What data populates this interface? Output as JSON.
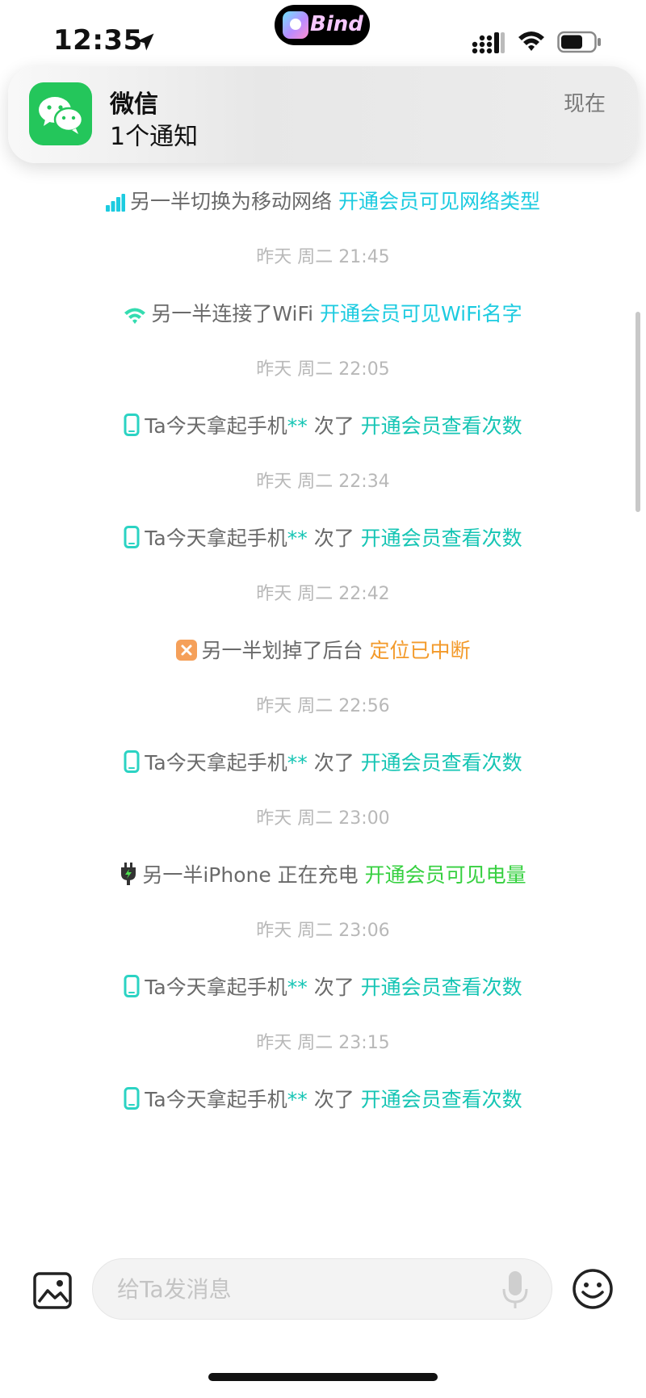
{
  "status_bar": {
    "time": "12:35",
    "island_app": "Bind"
  },
  "notification": {
    "app_name": "微信",
    "body": "1个通知",
    "time": "现在"
  },
  "feed": [
    {
      "kind": "event",
      "icon": "cellular-signal-icon",
      "text": "另一半切换为移动网络",
      "link": "开通会员可见网络类型",
      "link_color": "#1ccbe0"
    },
    {
      "kind": "time",
      "text": "昨天 周二 21:45"
    },
    {
      "kind": "event",
      "icon": "wifi-icon",
      "text": "另一半连接了WiFi",
      "link": "开通会员可见WiFi名字",
      "link_color": "#1ccbe0"
    },
    {
      "kind": "time",
      "text": "昨天 周二 22:05"
    },
    {
      "kind": "event",
      "icon": "phone-icon",
      "text": "Ta今天拿起手机",
      "stars": "**",
      "suffix": "次了",
      "link": "开通会员查看次数",
      "link_color": "#16c5b4"
    },
    {
      "kind": "time",
      "text": "昨天 周二 22:34"
    },
    {
      "kind": "event",
      "icon": "phone-icon",
      "text": "Ta今天拿起手机",
      "stars": "**",
      "suffix": "次了",
      "link": "开通会员查看次数",
      "link_color": "#16c5b4"
    },
    {
      "kind": "time",
      "text": "昨天 周二 22:42"
    },
    {
      "kind": "event",
      "icon": "close-square-icon",
      "text": "另一半划掉了后台",
      "link": "定位已中断",
      "link_color": "#f39a2a"
    },
    {
      "kind": "time",
      "text": "昨天 周二 22:56"
    },
    {
      "kind": "event",
      "icon": "phone-icon",
      "text": "Ta今天拿起手机",
      "stars": "**",
      "suffix": "次了",
      "link": "开通会员查看次数",
      "link_color": "#16c5b4"
    },
    {
      "kind": "time",
      "text": "昨天 周二 23:00"
    },
    {
      "kind": "event",
      "icon": "charger-plug-icon",
      "text": "另一半iPhone 正在充电",
      "link": "开通会员可见电量",
      "link_color": "#35d03f"
    },
    {
      "kind": "time",
      "text": "昨天 周二 23:06"
    },
    {
      "kind": "event",
      "icon": "phone-icon",
      "text": "Ta今天拿起手机",
      "stars": "**",
      "suffix": "次了",
      "link": "开通会员查看次数",
      "link_color": "#16c5b4"
    },
    {
      "kind": "time",
      "text": "昨天 周二 23:15"
    },
    {
      "kind": "event",
      "icon": "phone-icon",
      "text": "Ta今天拿起手机",
      "stars": "**",
      "suffix": "次了",
      "link": "开通会员查看次数",
      "link_color": "#16c5b4"
    }
  ],
  "composer": {
    "placeholder": "给Ta发消息"
  },
  "colors": {
    "accent_blue": "#1ccbe0",
    "accent_teal": "#16c5b4",
    "accent_orange": "#f39a2a",
    "accent_green": "#35d03f",
    "wechat_green": "#20c35a"
  }
}
